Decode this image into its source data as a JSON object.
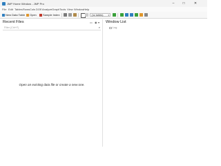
{
  "window": {
    "title": "JMP Home Window - JMP Pro",
    "controls": {
      "minimize": "–",
      "maximize": "□",
      "close": "✕"
    }
  },
  "menu": [
    "File",
    "Edit",
    "Tables",
    "Rows",
    "Cols",
    "DOE",
    "Analyze",
    "Graph",
    "Tools",
    "View",
    "Window",
    "Help"
  ],
  "toolbar": {
    "new_data_table": "New Data Table",
    "open": "Open",
    "sample_index": "Sample Index",
    "tables_select": "(no tables)"
  },
  "recent_files": {
    "title": "Recent Files",
    "filter_placeholder": "Filter (Ctrl+F)",
    "empty_message": "Open an existing data file or create a new one."
  },
  "window_list": {
    "title": "Window List",
    "items": [
      "Log"
    ]
  },
  "colors": {
    "accent_blue": "#2f7fbf",
    "open_orange": "#e0962b",
    "sample_red": "#c0392b",
    "green": "#3aa03a"
  }
}
